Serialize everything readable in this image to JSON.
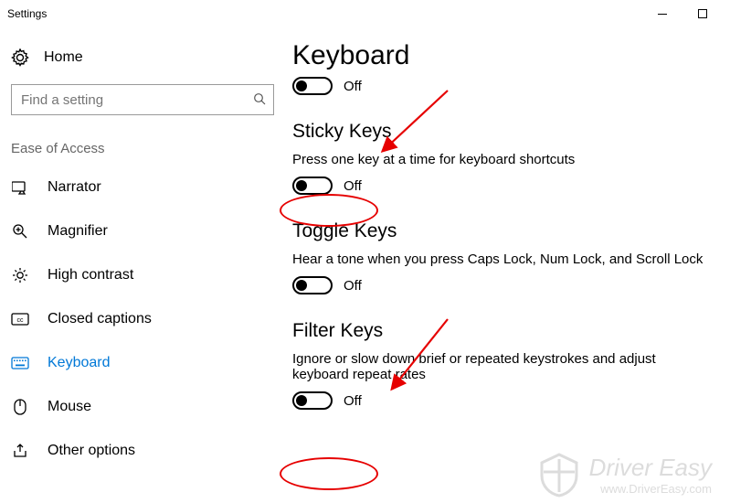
{
  "window": {
    "title": "Settings"
  },
  "sidebar": {
    "home_label": "Home",
    "search_placeholder": "Find a setting",
    "group_label": "Ease of Access",
    "items": [
      {
        "label": "Narrator"
      },
      {
        "label": "Magnifier"
      },
      {
        "label": "High contrast"
      },
      {
        "label": "Closed captions"
      },
      {
        "label": "Keyboard"
      },
      {
        "label": "Mouse"
      },
      {
        "label": "Other options"
      }
    ]
  },
  "content": {
    "title": "Keyboard",
    "main_toggle_state": "Off",
    "sections": [
      {
        "heading": "Sticky Keys",
        "desc": "Press one key at a time for keyboard shortcuts",
        "toggle_state": "Off"
      },
      {
        "heading": "Toggle Keys",
        "desc": "Hear a tone when you press Caps Lock, Num Lock, and Scroll Lock",
        "toggle_state": "Off"
      },
      {
        "heading": "Filter Keys",
        "desc": "Ignore or slow down brief or repeated keystrokes and adjust keyboard repeat rates",
        "toggle_state": "Off"
      }
    ]
  },
  "annotations": {
    "watermark_line1": "Driver Easy",
    "watermark_line2": "www.DriverEasy.com"
  }
}
